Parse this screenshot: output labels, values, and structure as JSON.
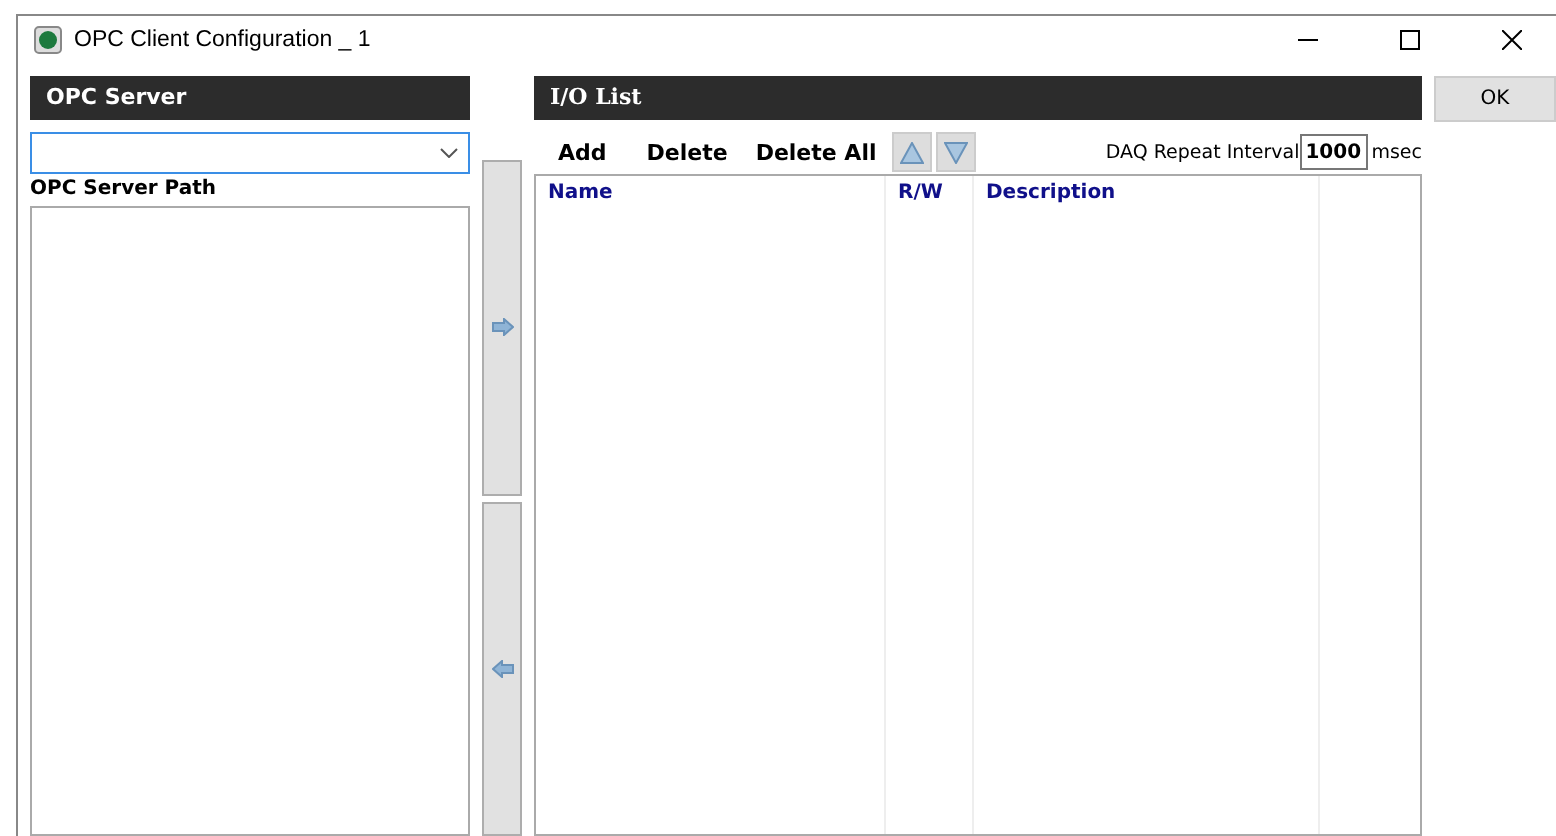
{
  "window": {
    "title": "OPC Client Configuration _ 1"
  },
  "opc_server": {
    "title": "OPC Server",
    "path_label": "OPC Server Path"
  },
  "io_list": {
    "title": "I/O List",
    "toolbar": [
      "Add",
      "Delete",
      "Delete All"
    ],
    "interval": {
      "label": "DAQ Repeat Interval",
      "value": "1000",
      "unit": "msec"
    },
    "columns": [
      "Name",
      "R/W",
      "Description"
    ]
  },
  "buttons": [
    "OK"
  ]
}
